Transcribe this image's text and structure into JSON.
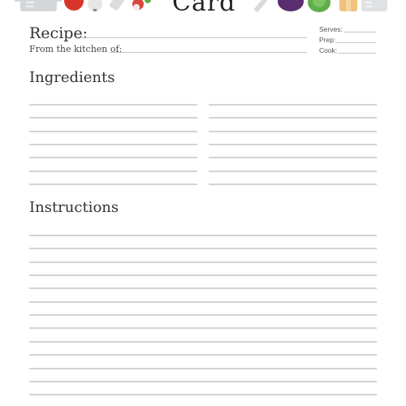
{
  "header": {
    "title_partial": "Card",
    "icons_left": [
      "pot-icon",
      "tomato-icon",
      "garlic-icon",
      "salt-shaker-icon",
      "radish-icon"
    ],
    "icons_right": [
      "knife-icon",
      "eggplant-icon",
      "lettuce-icon",
      "bread-icon",
      "container-icon"
    ]
  },
  "form": {
    "recipe_label": "Recipe:",
    "kitchen_label": "From the kitchen of:",
    "serves_label": "Serves:",
    "prep_label": "Prep:",
    "cook_label": "Cook:"
  },
  "sections": {
    "ingredients_title": "Ingredients",
    "ingredients_lines_per_column": 7,
    "ingredients_columns": 2,
    "instructions_title": "Instructions",
    "instructions_lines": 13
  },
  "colors": {
    "tomato": "#d9342b",
    "eggplant": "#5a2d6e",
    "lettuce": "#5fae4a",
    "bread": "#f0c27b",
    "gray_icon": "#d4d7da",
    "rule": "#d4d4d4"
  }
}
